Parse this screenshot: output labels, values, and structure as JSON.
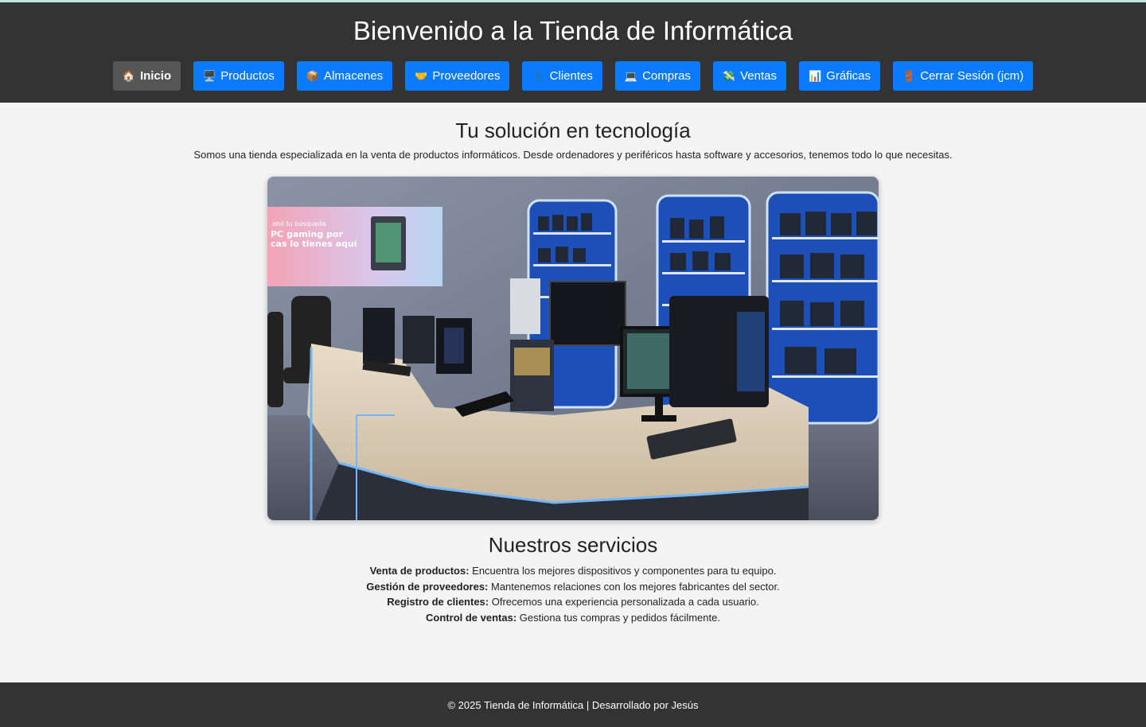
{
  "header": {
    "title": "Bienvenido a la Tienda de Informática"
  },
  "nav": {
    "items": [
      {
        "icon": "house-icon",
        "glyph": "🏠",
        "label": "Inicio",
        "active": true
      },
      {
        "icon": "desktop-icon",
        "glyph": "🖥️",
        "label": "Productos"
      },
      {
        "icon": "package-icon",
        "glyph": "📦",
        "label": "Almacenes"
      },
      {
        "icon": "handshake-icon",
        "glyph": "🤝",
        "label": "Proveedores"
      },
      {
        "icon": "user-icon",
        "glyph": "👤",
        "label": "Clientes"
      },
      {
        "icon": "computer-icon",
        "glyph": "💻",
        "label": "Compras"
      },
      {
        "icon": "money-icon",
        "glyph": "💸",
        "label": "Ventas"
      },
      {
        "icon": "chart-icon",
        "glyph": "📊",
        "label": "Gráficas"
      },
      {
        "icon": "door-icon",
        "glyph": "🚪",
        "label": "Cerrar Sesión (jcm)"
      }
    ]
  },
  "main": {
    "heading": "Tu solución en tecnología",
    "intro": "Somos una tienda especializada en la venta de productos informáticos. Desde ordenadores y periféricos hasta software y accesorios, tenemos todo lo que necesitas.",
    "services_heading": "Nuestros servicios",
    "services": [
      {
        "title": "Venta de productos:",
        "text": " Encuentra los mejores dispositivos y componentes para tu equipo."
      },
      {
        "title": "Gestión de proveedores:",
        "text": " Mantenemos relaciones con los mejores fabricantes del sector."
      },
      {
        "title": "Registro de clientes:",
        "text": " Ofrecemos una experiencia personalizada a cada usuario."
      },
      {
        "title": "Control de ventas:",
        "text": " Gestiona tus compras y pedidos fácilmente."
      }
    ]
  },
  "footer": {
    "text": "© 2025 Tienda de Informática | Desarrollado por Jesús"
  },
  "colors": {
    "header_bg": "#333333",
    "nav_button": "#0a7bff",
    "nav_active": "#555555",
    "page_bg": "#f4f4f4"
  }
}
